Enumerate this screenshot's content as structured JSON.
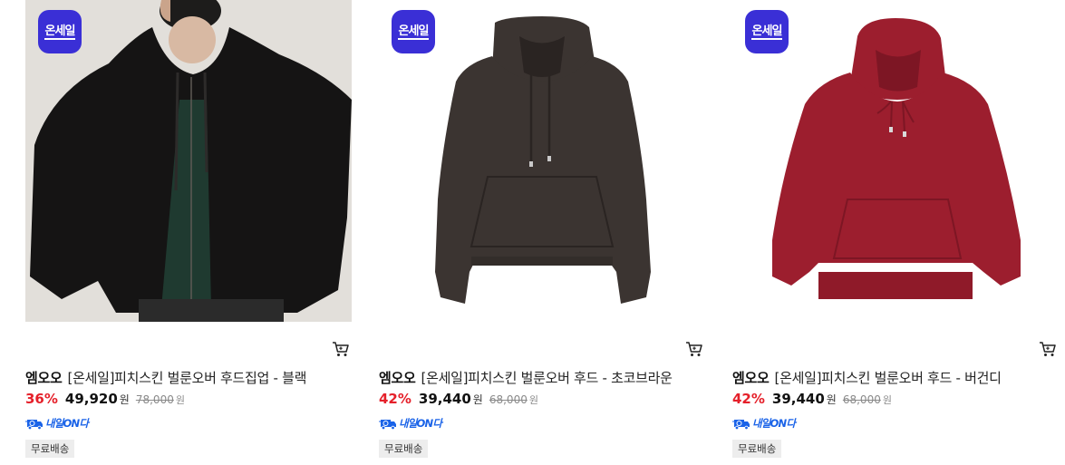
{
  "products": [
    {
      "badge": "온세일",
      "brand": "엠오오",
      "name": "[온세일]피치스킨 벌룬오버 후드집업 - 블랙",
      "discount_rate": "36%",
      "sale_price": "49,920",
      "sale_unit": "원",
      "original_price": "78,000",
      "original_unit": "원",
      "delivery": "내일ON다",
      "tag": "무료배송",
      "cart_icon": "cart-icon",
      "image_colors": {
        "bg": "#e9e6e2",
        "garment": "#151414"
      }
    },
    {
      "badge": "온세일",
      "brand": "엠오오",
      "name": "[온세일]피치스킨 벌룬오버 후드 - 초코브라운",
      "discount_rate": "42%",
      "sale_price": "39,440",
      "sale_unit": "원",
      "original_price": "68,000",
      "original_unit": "원",
      "delivery": "내일ON다",
      "tag": "무료배송",
      "cart_icon": "cart-icon",
      "image_colors": {
        "bg": "#ffffff",
        "garment": "#3b3431"
      }
    },
    {
      "badge": "온세일",
      "brand": "엠오오",
      "name": "[온세일]피치스킨 벌룬오버 후드 - 버건디",
      "discount_rate": "42%",
      "sale_price": "39,440",
      "sale_unit": "원",
      "original_price": "68,000",
      "original_unit": "원",
      "delivery": "내일ON다",
      "tag": "무료배송",
      "cart_icon": "cart-icon",
      "image_colors": {
        "bg": "#ffffff",
        "garment": "#9c1e2e"
      }
    }
  ],
  "colors": {
    "badge_bg": "#3a2fd6",
    "discount": "#e5202a",
    "delivery": "#1a63e8",
    "tag_bg": "#ededed"
  }
}
